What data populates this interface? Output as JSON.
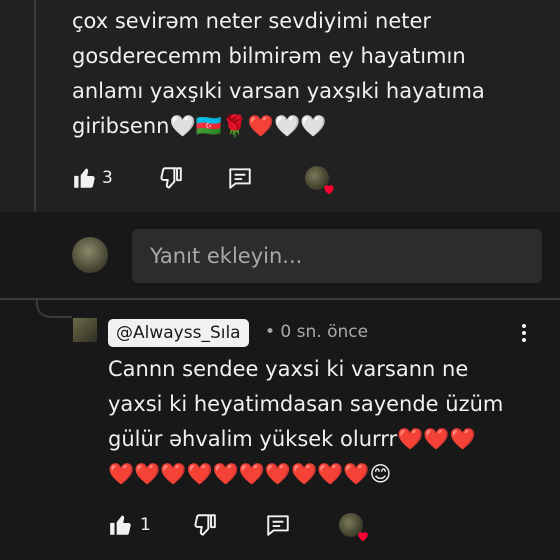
{
  "comment": {
    "text": "çox sevirəm neter sevdiyimi neter\ngosderecemm bilmirəm ey hayatımın\nanlamı yaxşıki varsan yaxşıki hayatıma\ngiribsenn🤍🇦🇿🌹❤️🤍🤍",
    "like_count": "3"
  },
  "reply_box": {
    "placeholder": "Yanıt ekleyin..."
  },
  "reply": {
    "mention": "@Alwayss_Sıla",
    "meta": "• 0 sn. önce",
    "text": "Cannn sendee yaxsi ki varsann ne\nyaxsi ki heyatimdasan sayende üzüm\ngülür  əhvalim yüksek olurrr❤️❤️❤️\n❤️❤️❤️❤️❤️❤️❤️❤️❤️❤️😊",
    "like_count": "1"
  },
  "icons": {
    "like": "thumbs-up-icon",
    "dislike": "thumbs-down-icon",
    "reply": "comment-icon",
    "more": "more-vert-icon",
    "heart": "heart-icon"
  },
  "colors": {
    "background": "#181818",
    "comment_bg": "#212121",
    "heart": "#ff0033",
    "input_bg": "#2c2c2c"
  }
}
